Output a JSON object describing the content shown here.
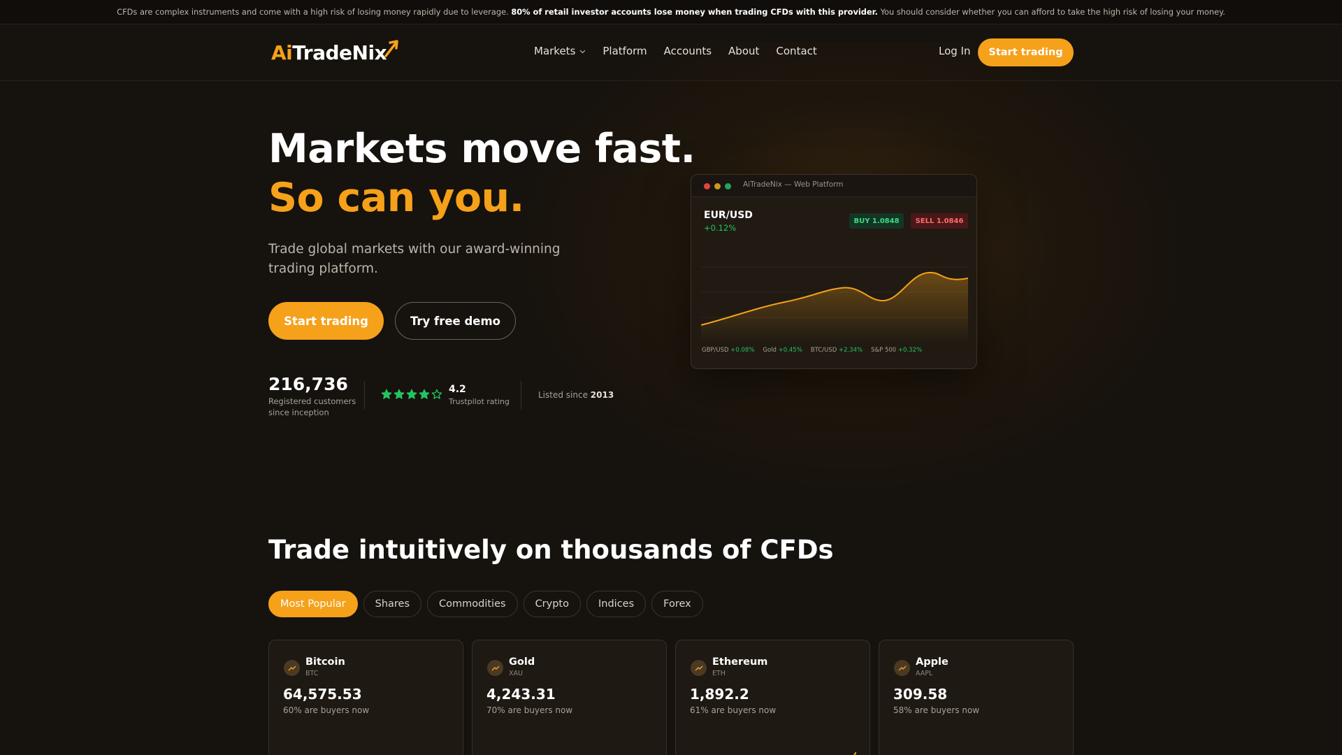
{
  "risk_warning": {
    "pre": "CFDs are complex instruments and come with a high risk of losing money rapidly due to leverage. ",
    "bold": "80% of retail investor accounts lose money when trading CFDs with this provider.",
    "post": " You should consider whether you can afford to take the high risk of losing your money."
  },
  "brand": {
    "prefix": "Ai",
    "rest": "TradeNix"
  },
  "nav": {
    "items": [
      "Markets",
      "Platform",
      "Accounts",
      "About",
      "Contact"
    ],
    "login": "Log In",
    "cta": "Start trading"
  },
  "hero": {
    "title_line1": "Markets move fast.",
    "title_line2": "So can you.",
    "subtitle": "Trade global markets with our award-winning trading platform.",
    "primary_cta": "Start trading",
    "secondary_cta": "Try free demo",
    "customers": "216,736",
    "customers_label": "Registered customers since inception",
    "rating": "4.2",
    "rating_label": "Trustpilot rating",
    "stars": 4,
    "listed_prefix": "Listed since ",
    "listed_year": "2013"
  },
  "platform": {
    "window_title": "AiTradeNix — Web Platform",
    "pair": "EUR/USD",
    "change": "+0.12%",
    "buy": "BUY 1.0848",
    "sell": "SELL 1.0846",
    "tickers": [
      {
        "name": "GBP/USD",
        "change": "+0.08%"
      },
      {
        "name": "Gold",
        "change": "+0.45%"
      },
      {
        "name": "BTC/USD",
        "change": "+2.34%"
      },
      {
        "name": "S&P 500",
        "change": "+0.32%"
      }
    ],
    "colors": {
      "accent": "#f5a11a",
      "up": "#22c55e",
      "down": "#ff6b6b"
    }
  },
  "section": {
    "title": "Trade intuitively on thousands of CFDs",
    "tabs": [
      "Most Popular",
      "Shares",
      "Commodities",
      "Crypto",
      "Indices",
      "Forex"
    ],
    "active_tab": "Most Popular"
  },
  "instruments": [
    {
      "name": "Bitcoin",
      "symbol": "BTC",
      "price": "64,575.53",
      "buyers": "60% are buyers now",
      "icon": "trend-up-icon"
    },
    {
      "name": "Gold",
      "symbol": "XAU",
      "price": "4,243.31",
      "buyers": "70% are buyers now",
      "icon": "trend-up-icon"
    },
    {
      "name": "Ethereum",
      "symbol": "ETH",
      "price": "1,892.2",
      "buyers": "61% are buyers now",
      "icon": "trend-up-icon"
    },
    {
      "name": "Apple",
      "symbol": "AAPL",
      "price": "309.58",
      "buyers": "58% are buyers now",
      "icon": "trend-up-icon"
    }
  ]
}
